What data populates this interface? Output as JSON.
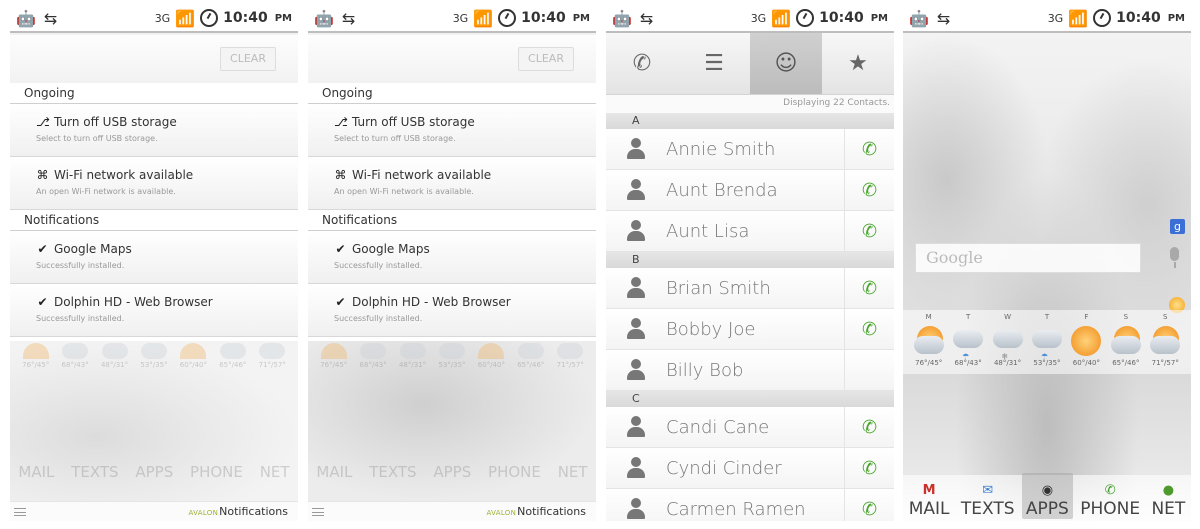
{
  "statusbar": {
    "network": "3G",
    "time": "10:40",
    "ampm": "PM"
  },
  "notifications": {
    "clear_label": "CLEAR",
    "ongoing_header": "Ongoing",
    "notifications_header": "Notifications",
    "ongoing": [
      {
        "title": "Turn off USB storage",
        "subtitle": "Select to turn off USB storage.",
        "icon": "usb-icon"
      },
      {
        "title": "Wi-Fi network available",
        "subtitle": "An open Wi-Fi network is available.",
        "icon": "wifi-icon"
      }
    ],
    "items": [
      {
        "title": "Google Maps",
        "subtitle": "Successfully installed.",
        "icon": "checkmark-icon"
      },
      {
        "title": "Dolphin HD - Web Browser",
        "subtitle": "Successfully installed.",
        "icon": "checkmark-icon"
      }
    ],
    "brand_prefix": "AVALON",
    "brand_title": "Notifications"
  },
  "contacts": {
    "count_text": "Displaying 22 Contacts.",
    "tabs": [
      "phone",
      "list",
      "contacts",
      "favorites"
    ],
    "groups": [
      {
        "letter": "A",
        "names": [
          "Annie Smith",
          "Aunt Brenda",
          "Aunt Lisa"
        ]
      },
      {
        "letter": "B",
        "names": [
          "Brian Smith",
          "Bobby Joe",
          "Billy Bob"
        ]
      },
      {
        "letter": "C",
        "names": [
          "Candi Cane",
          "Cyndi Cinder",
          "Carmen Ramen"
        ]
      }
    ]
  },
  "home": {
    "search_placeholder": "Google",
    "google_badge": "g",
    "weather": [
      {
        "day": "M",
        "temp": "76°/45°",
        "icon": "partly-sunny-icon"
      },
      {
        "day": "T",
        "temp": "68°/43°",
        "icon": "rain-icon"
      },
      {
        "day": "W",
        "temp": "48°/31°",
        "icon": "snow-icon"
      },
      {
        "day": "T",
        "temp": "53°/35°",
        "icon": "rain-icon"
      },
      {
        "day": "F",
        "temp": "60°/40°",
        "icon": "sunny-icon"
      },
      {
        "day": "S",
        "temp": "65°/46°",
        "icon": "partly-sunny-icon"
      },
      {
        "day": "S",
        "temp": "71°/57°",
        "icon": "partly-sunny-icon"
      }
    ],
    "dock": [
      {
        "label": "MAIL",
        "icon": "gmail-icon"
      },
      {
        "label": "TEXTS",
        "icon": "messaging-icon"
      },
      {
        "label": "APPS",
        "icon": "apps-icon"
      },
      {
        "label": "PHONE",
        "icon": "phone-icon"
      },
      {
        "label": "NET",
        "icon": "globe-icon"
      }
    ]
  }
}
